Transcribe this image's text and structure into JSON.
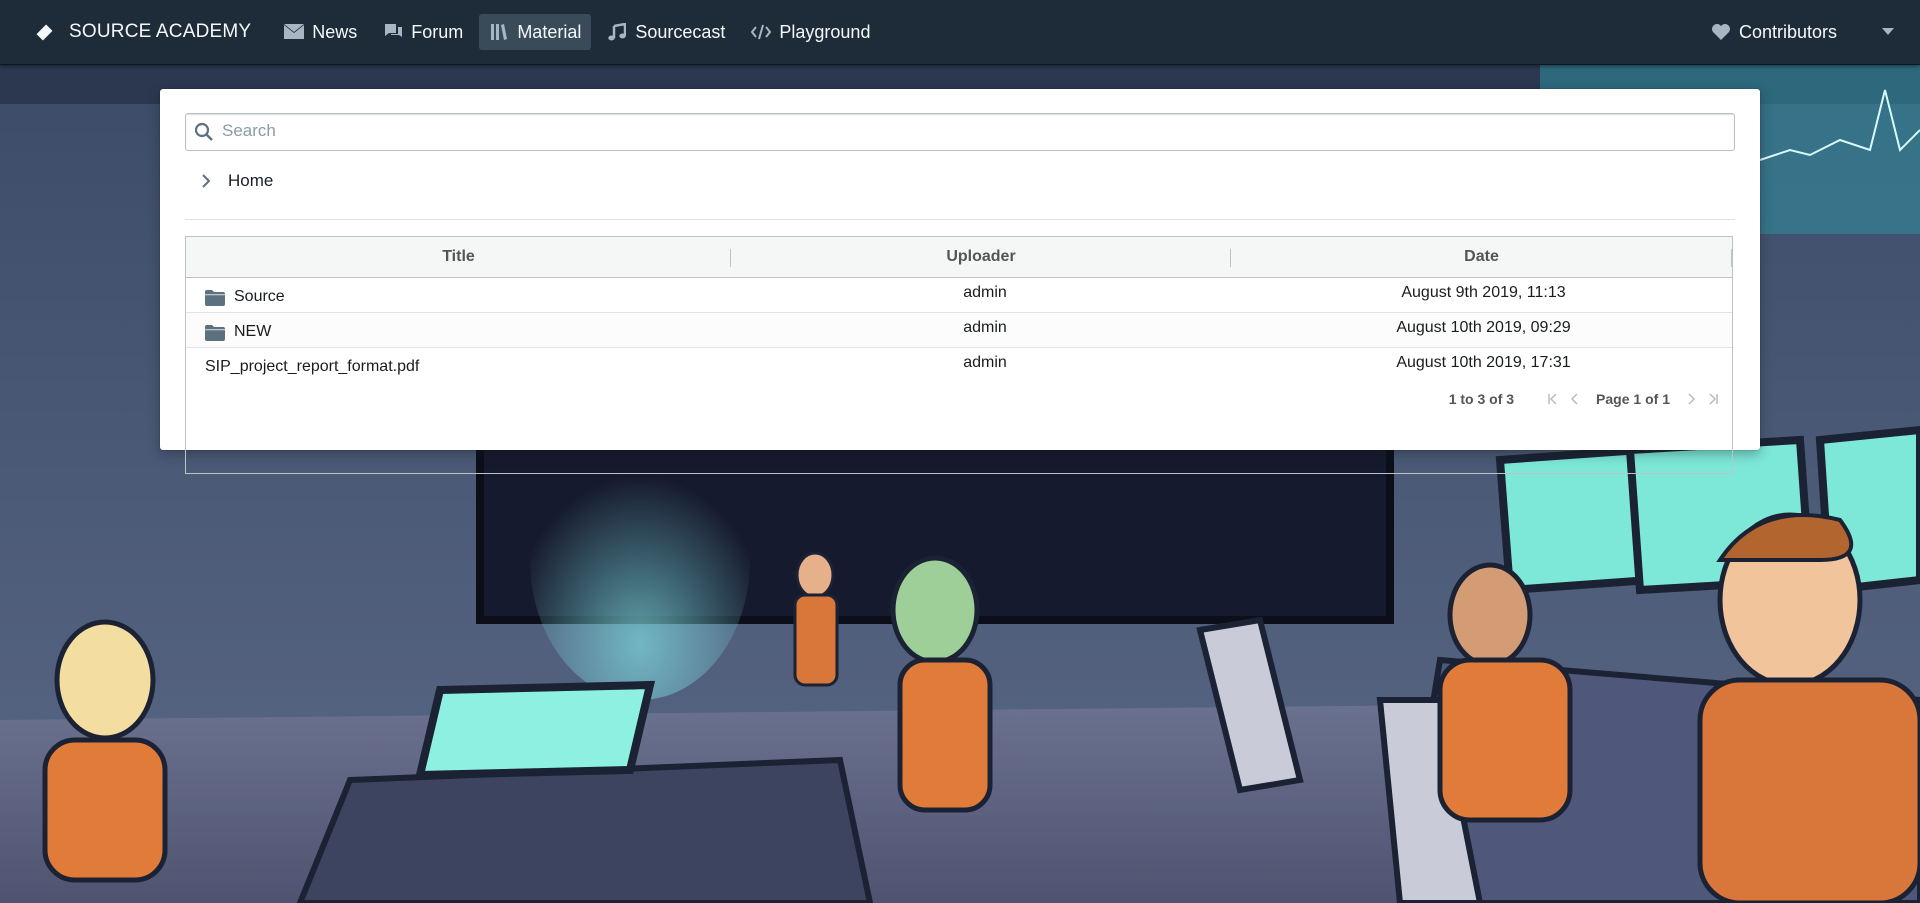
{
  "navbar": {
    "brand": "SOURCE ACADEMY",
    "items": [
      {
        "label": "News",
        "icon": "envelope-icon"
      },
      {
        "label": "Forum",
        "icon": "chat-icon"
      },
      {
        "label": "Material",
        "icon": "library-icon",
        "active": true
      },
      {
        "label": "Sourcecast",
        "icon": "music-icon"
      },
      {
        "label": "Playground",
        "icon": "code-icon"
      }
    ],
    "contributors_label": "Contributors"
  },
  "material": {
    "search": {
      "placeholder": "Search",
      "value": ""
    },
    "breadcrumb": {
      "label": "Home"
    },
    "table": {
      "columns": [
        "Title",
        "Uploader",
        "Date"
      ],
      "rows": [
        {
          "type": "folder",
          "title": "Source",
          "uploader": "admin",
          "date": "August 9th 2019, 11:13"
        },
        {
          "type": "folder",
          "title": "NEW",
          "uploader": "admin",
          "date": "August 10th 2019, 09:29"
        },
        {
          "type": "file",
          "title": "SIP_project_report_format.pdf",
          "uploader": "admin",
          "date": "August 10th 2019, 17:31"
        }
      ]
    },
    "paging": {
      "summary": "1 to 3 of 3",
      "page_prefix": "Page",
      "page_current": "1",
      "page_of": "of",
      "page_total": "1"
    }
  },
  "colors": {
    "navbar_bg": "#1e2b38",
    "active_tab_bg": "#394b59",
    "folder_icon": "#5c7080"
  }
}
